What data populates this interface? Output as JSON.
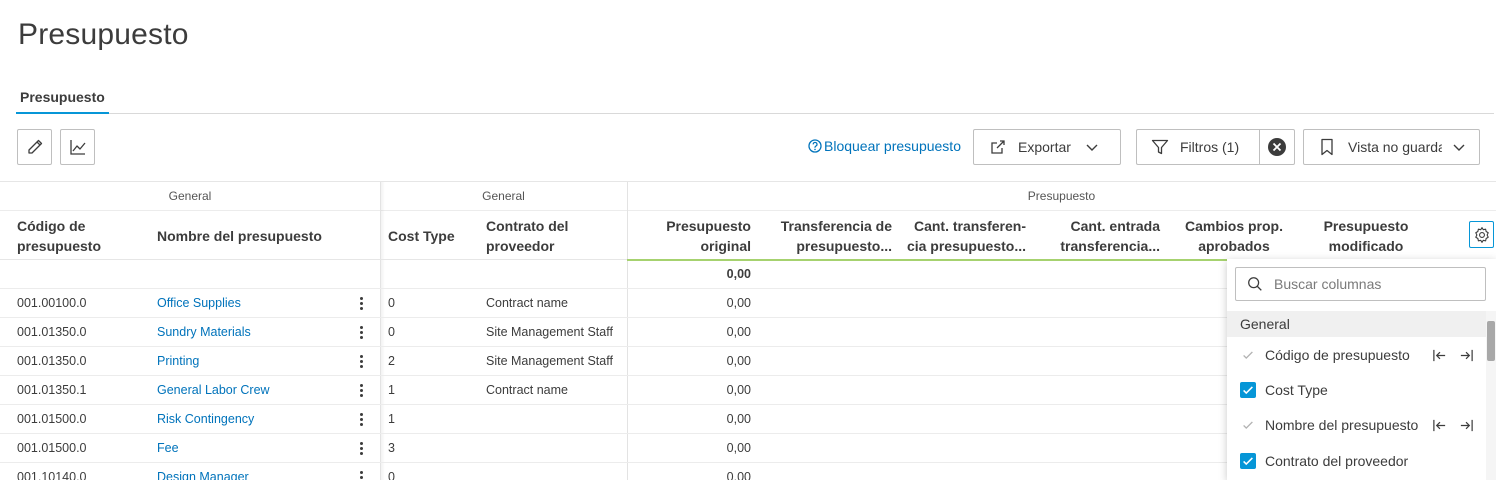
{
  "page": {
    "title": "Presupuesto"
  },
  "tabs": [
    {
      "label": "Presupuesto"
    }
  ],
  "toolbar": {
    "edit_icon": "pencil-icon",
    "chart_icon": "line-chart-icon",
    "lock_label": "Bloquear presupuesto",
    "export_label": "Exportar",
    "filters_label": "Filtros (1)",
    "view_label": "Vista no guardada"
  },
  "grid": {
    "groups": [
      "General",
      "General",
      "Presupuesto"
    ],
    "columns": {
      "code": [
        "Código de",
        "presupuesto"
      ],
      "name": "Nombre del presupuesto",
      "cost_type": "Cost Type",
      "contract": [
        "Contrato del",
        "proveedor"
      ],
      "original": [
        "Presupuesto",
        "original"
      ],
      "transfer": [
        "Transferencia de",
        "presupuesto..."
      ],
      "transfer_qty": [
        "Cant. transferen-",
        "cia presupuesto..."
      ],
      "transfer_in": [
        "Cant. entrada",
        "transferencia..."
      ],
      "changes": [
        "Cambios prop.",
        "aprobados"
      ],
      "modified": [
        "Presupuesto",
        "modificado"
      ]
    },
    "total_original": "0,00",
    "rows": [
      {
        "code": "001.00100.0",
        "name": "Office Supplies",
        "cost_type": "0",
        "contract": "Contract name",
        "original": "0,00"
      },
      {
        "code": "001.01350.0",
        "name": "Sundry Materials",
        "cost_type": "0",
        "contract": "Site Management Staff",
        "original": "0,00"
      },
      {
        "code": "001.01350.0",
        "name": "Printing",
        "cost_type": "2",
        "contract": "Site Management Staff",
        "original": "0,00"
      },
      {
        "code": "001.01350.1",
        "name": "General Labor Crew",
        "cost_type": "1",
        "contract": "Contract name",
        "original": "0,00"
      },
      {
        "code": "001.01500.0",
        "name": "Risk Contingency",
        "cost_type": "1",
        "contract": "",
        "original": "0,00"
      },
      {
        "code": "001.01500.0",
        "name": "Fee",
        "cost_type": "3",
        "contract": "",
        "original": "0,00"
      },
      {
        "code": "001.10140.0",
        "name": "Design Manager",
        "cost_type": "0",
        "contract": "",
        "original": "0,00"
      }
    ]
  },
  "column_panel": {
    "search_placeholder": "Buscar columnas",
    "group_label": "General",
    "options": [
      {
        "label": "Código de presupuesto",
        "state": "disabled-checked",
        "pinnable": true
      },
      {
        "label": "Cost Type",
        "state": "checked",
        "pinnable": false
      },
      {
        "label": "Nombre del presupuesto",
        "state": "disabled-checked",
        "pinnable": true
      },
      {
        "label": "Contrato del proveedor",
        "state": "checked",
        "pinnable": false
      }
    ]
  },
  "colors": {
    "accent": "#0696d7",
    "link": "#0073bb",
    "budget_line": "#a6d26f"
  }
}
